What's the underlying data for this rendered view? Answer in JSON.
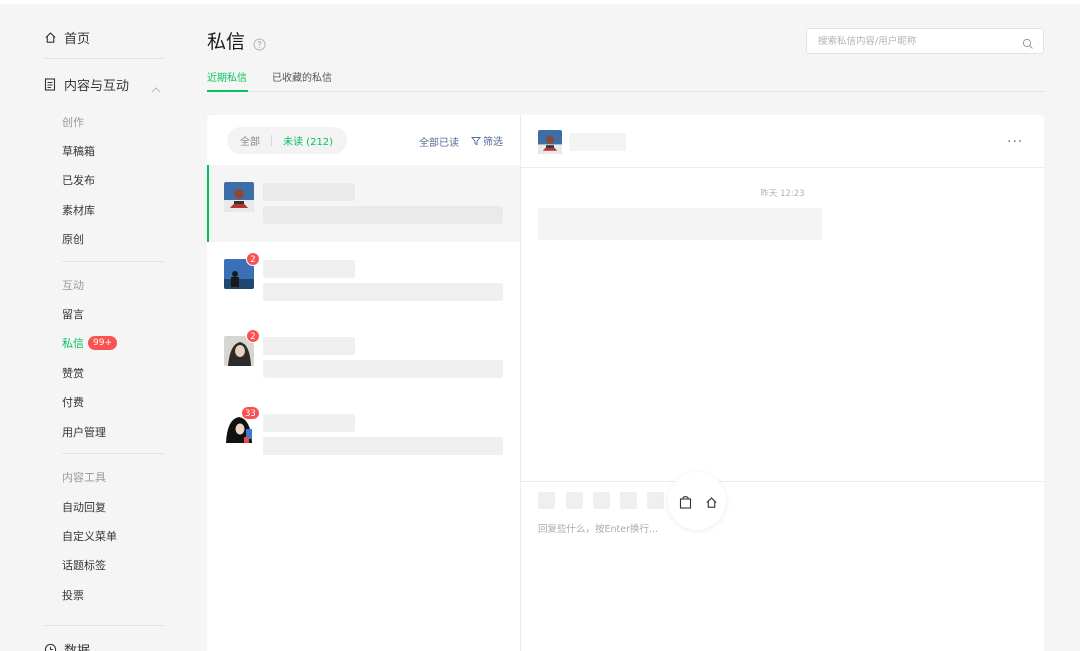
{
  "sidebar": {
    "home": "首页",
    "content_section": "内容与互动",
    "group_create": "创作",
    "create_items": [
      "草稿箱",
      "已发布",
      "素材库",
      "原创"
    ],
    "group_interact": "互动",
    "interact_items": [
      "留言",
      "私信",
      "赞赏",
      "付费",
      "用户管理"
    ],
    "messages_badge": "99+",
    "group_tools": "内容工具",
    "tools_items": [
      "自动回复",
      "自定义菜单",
      "话题标签",
      "投票"
    ],
    "data_section": "数据"
  },
  "header": {
    "title": "私信",
    "search_placeholder": "搜索私信内容/用户昵称",
    "tabs": [
      "近期私信",
      "已收藏的私信"
    ]
  },
  "conversation_list": {
    "filter_all": "全部",
    "filter_unread": "未读 (212)",
    "mark_all_read": "全部已读",
    "filter_button": "筛选",
    "unread_counts": [
      "2",
      "2",
      "33"
    ]
  },
  "chat": {
    "timestamp": "昨天 12:23",
    "more": "···",
    "composer_placeholder": "回复些什么，按Enter换行..."
  },
  "colors": {
    "accent": "#07c160",
    "badge": "#fa5151",
    "link": "#576b95"
  }
}
